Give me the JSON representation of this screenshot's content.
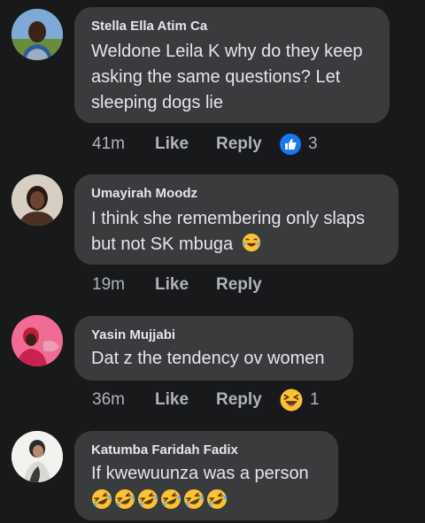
{
  "comments": [
    {
      "author": "Stella Ella Atim Ca",
      "text": "Weldone Leila K why do they keep asking the same questions? Let sleeping dogs lie",
      "time": "41m",
      "like_label": "Like",
      "reply_label": "Reply",
      "reaction_icon": "like-reaction-icon",
      "reaction_count": "3"
    },
    {
      "author": "Umayirah Moodz",
      "text": "I think she remembering only slaps but not SK mbuga",
      "time": "19m",
      "like_label": "Like",
      "reply_label": "Reply"
    },
    {
      "author": "Yasin Mujjabi",
      "text": "Dat z the tendency ov women",
      "time": "36m",
      "like_label": "Like",
      "reply_label": "Reply",
      "reaction_icon": "haha-reaction-icon",
      "reaction_count": "1"
    },
    {
      "author": "Katumba Faridah Fadix",
      "text": "If kwewuunza was a person",
      "emoji_icon": "rolling-on-floor-laughing-emoji",
      "emoji_count": 6
    }
  ],
  "colors": {
    "background": "#18191a",
    "bubble": "#3a3b3c",
    "primary_text": "#e4e6eb",
    "secondary_text": "#b0b3b8",
    "like_blue": "#1877f2"
  }
}
